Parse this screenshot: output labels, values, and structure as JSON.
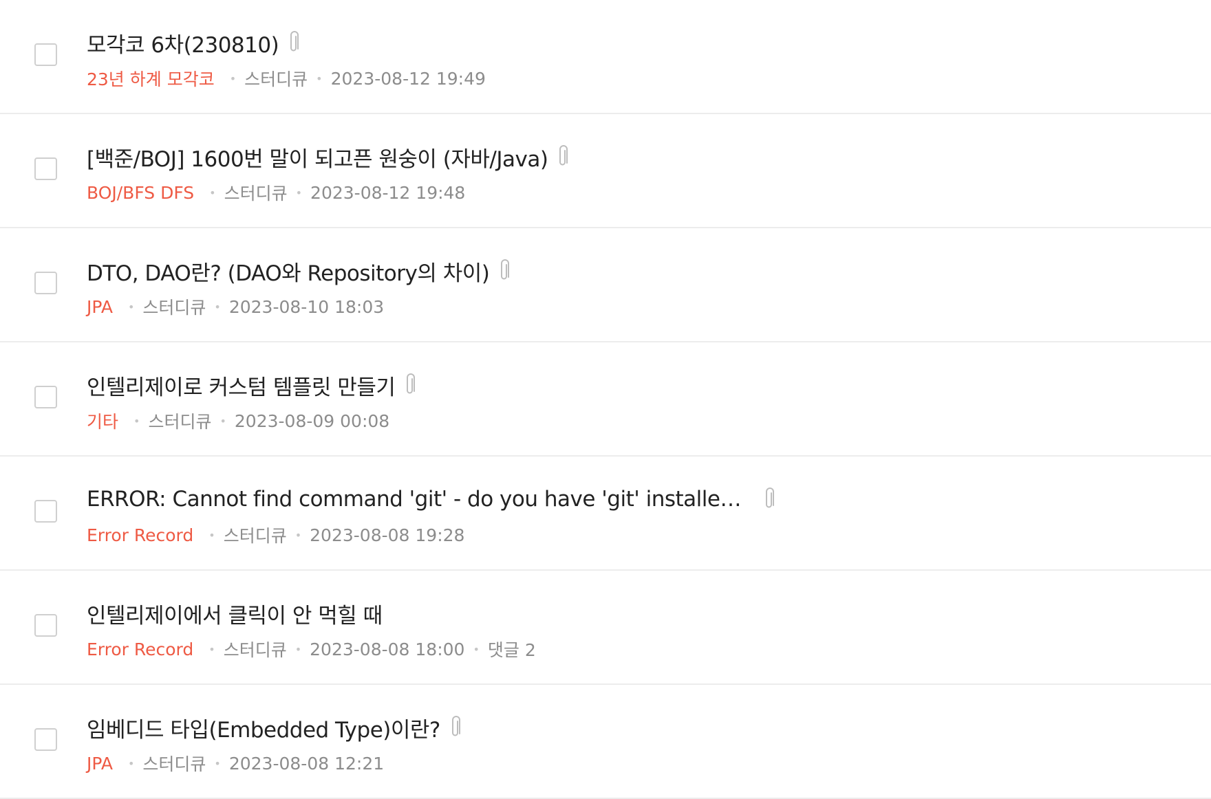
{
  "posts": [
    {
      "title": "모각코 6차(230810)",
      "category": "23년 하계 모각코",
      "author": "스터디큐",
      "date": "2023-08-12 19:49",
      "attachment": true,
      "comments": null
    },
    {
      "title": "[백준/BOJ] 1600번 말이 되고픈 원숭이 (자바/Java)",
      "category": "BOJ/BFS DFS",
      "author": "스터디큐",
      "date": "2023-08-12 19:48",
      "attachment": true,
      "comments": null
    },
    {
      "title": "DTO, DAO란? (DAO와 Repository의 차이)",
      "category": "JPA",
      "author": "스터디큐",
      "date": "2023-08-10 18:03",
      "attachment": true,
      "comments": null
    },
    {
      "title": "인텔리제이로 커스텀 템플릿 만들기",
      "category": "기타",
      "author": "스터디큐",
      "date": "2023-08-09 00:08",
      "attachment": true,
      "comments": null
    },
    {
      "title": "ERROR: Cannot find command 'git' - do you have 'git' installed an…",
      "category": "Error Record",
      "author": "스터디큐",
      "date": "2023-08-08 19:28",
      "attachment": true,
      "comments": null
    },
    {
      "title": "인텔리제이에서 클릭이 안 먹힐 때",
      "category": "Error Record",
      "author": "스터디큐",
      "date": "2023-08-08 18:00",
      "attachment": false,
      "comments": "댓글 2"
    },
    {
      "title": "임베디드 타입(Embedded Type)이란?",
      "category": "JPA",
      "author": "스터디큐",
      "date": "2023-08-08 12:21",
      "attachment": true,
      "comments": null
    }
  ],
  "icons": {
    "attachment": "paperclip-icon"
  },
  "colors": {
    "category": "#ee5a44",
    "meta": "#8c8c8c",
    "title": "#222222",
    "divider": "#ececec"
  }
}
